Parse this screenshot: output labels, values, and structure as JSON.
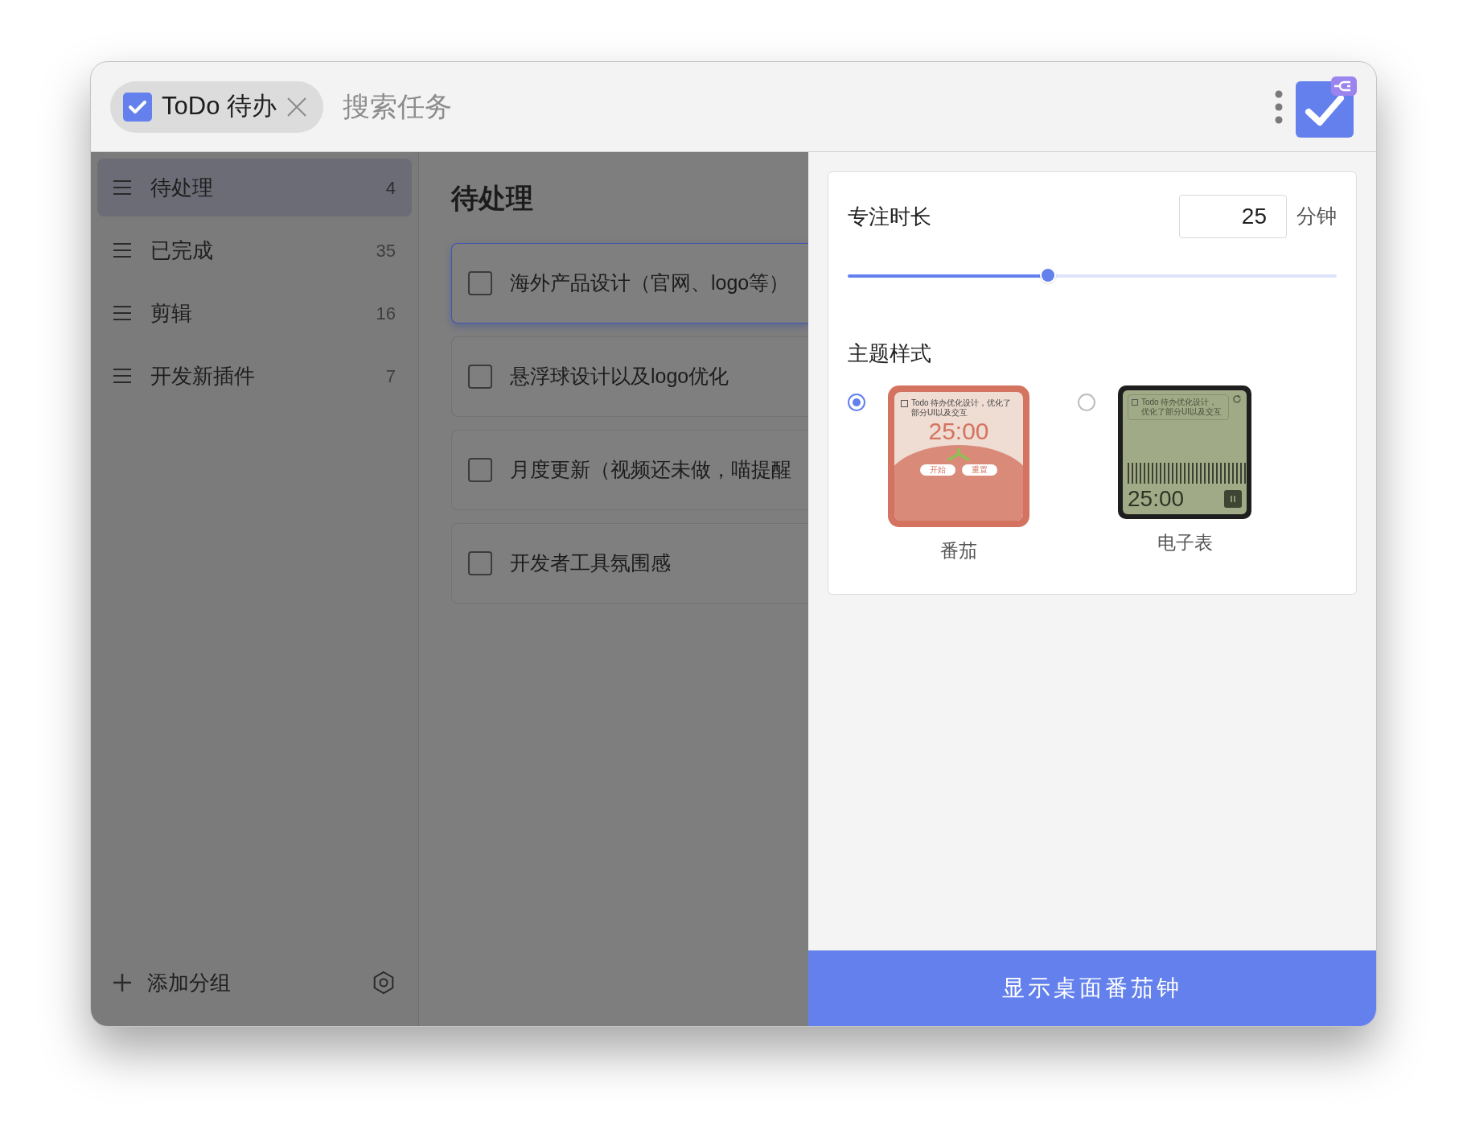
{
  "app_tab": {
    "label": "ToDo 待办"
  },
  "search": {
    "placeholder": "搜索任务"
  },
  "sidebar": {
    "items": [
      {
        "label": "待处理",
        "count": "4",
        "selected": true
      },
      {
        "label": "已完成",
        "count": "35",
        "selected": false
      },
      {
        "label": "剪辑",
        "count": "16",
        "selected": false
      },
      {
        "label": "开发新插件",
        "count": "7",
        "selected": false
      }
    ],
    "add_group": "添加分组"
  },
  "list": {
    "title": "待处理",
    "tasks": [
      {
        "text": "海外产品设计（官网、logo等）",
        "checked": false,
        "selected": true
      },
      {
        "text": "悬浮球设计以及logo优化",
        "checked": false,
        "selected": false
      },
      {
        "text": "月度更新（视频还未做，喵提醒",
        "checked": false,
        "selected": false
      },
      {
        "text": "开发者工具氛围感",
        "checked": false,
        "selected": false
      }
    ]
  },
  "settings": {
    "duration_label": "专注时长",
    "duration_value": "25",
    "unit": "分钟",
    "duration_slider": {
      "level": 0.41
    },
    "theme_label": "主题样式",
    "themes": [
      {
        "kind": "tomato",
        "label": "番茄",
        "selected": true,
        "preview": {
          "checked": false,
          "task": "Todo 待办优化设计，优化了部分UI以及交互",
          "time": "25:00",
          "buttons": [
            "开始",
            "重置"
          ]
        }
      },
      {
        "kind": "lcd",
        "label": "电子表",
        "selected": false,
        "preview": {
          "checked": false,
          "task": "Todo 待办优化设计，优化了部分UI以及交互",
          "time": "25:00"
        }
      }
    ]
  },
  "primary_button": "显示桌面番茄钟"
}
